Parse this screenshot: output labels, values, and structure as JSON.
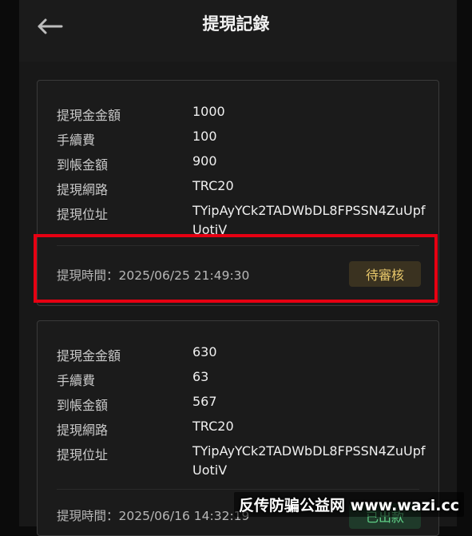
{
  "header": {
    "title": "提現記錄",
    "back_icon": "arrow-left-icon"
  },
  "labels": {
    "amount": "提現金金額",
    "fee": "手續費",
    "received": "到帳金額",
    "network": "提現網路",
    "address": "提現位址",
    "time_prefix": "提現時間："
  },
  "records": [
    {
      "amount": "1000",
      "fee": "100",
      "received": "900",
      "network": "TRC20",
      "address": "TYipAyYCk2TADWbDL8FPSSN4ZuUpfUotiV",
      "time": "2025/06/25 21:49:30",
      "status": "待審核"
    },
    {
      "amount": "630",
      "fee": "63",
      "received": "567",
      "network": "TRC20",
      "address": "TYipAyYCk2TADWbDL8FPSSN4ZuUpfUotiV",
      "time": "2025/06/16 14:32:19",
      "status": "已出款"
    }
  ],
  "watermark": "反传防骗公益网 www.wazi.cc",
  "colors": {
    "highlight": "#e60012",
    "pending": "#e6c66a",
    "done": "#5fcf86"
  }
}
